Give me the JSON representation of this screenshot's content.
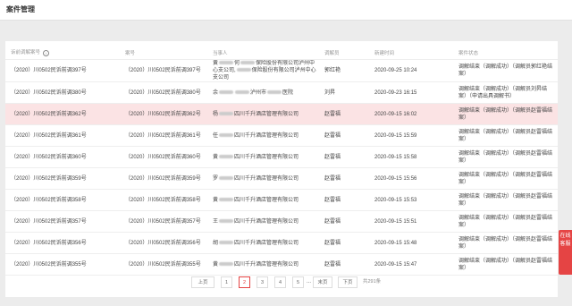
{
  "page_title": "案件管理",
  "columns": [
    "诉前调解案号",
    "案号",
    "当事人",
    "调解员",
    "新建时间",
    "案件状态"
  ],
  "rows": [
    {
      "pre_no": "（2020）川0502民诉前调397号",
      "case_no": "（2020）川0502民诉前调397号",
      "party_a": "黄",
      "party_a2": "何",
      "party_b": "保险股份有限公司泸州中心支公司,",
      "party_c": "保险股份有限公司泸州中心支公司",
      "mediator": "郭红艳",
      "created": "2020-09-25 10:24",
      "status": "调解结束（调解成功）（调解员郭红艳结案）",
      "highlight": false
    },
    {
      "pre_no": "（2020）川0502民诉前调380号",
      "case_no": "（2020）川0502民诉前调380号",
      "party_a": "余",
      "party_a2": "",
      "party_b": "泸州市",
      "party_c": "医院",
      "mediator": "刘昇",
      "created": "2020-09-23 16:15",
      "status": "调解结束（调解成功）（调解员刘昇结案）（申请出具调解书）",
      "highlight": false
    },
    {
      "pre_no": "（2020）川0502民诉前调362号",
      "case_no": "（2020）川0502民诉前调362号",
      "party_a": "杨",
      "party_a2": "",
      "party_b": "四川千升酒店管理有限公司",
      "party_c": "",
      "mediator": "赵雷福",
      "created": "2020-09-15 16:02",
      "status": "调解结束（调解成功）（调解员赵雷福结案）",
      "highlight": true
    },
    {
      "pre_no": "（2020）川0502民诉前调361号",
      "case_no": "（2020）川0502民诉前调361号",
      "party_a": "任",
      "party_a2": "",
      "party_b": "四川千升酒店管理有限公司",
      "party_c": "",
      "mediator": "赵雷福",
      "created": "2020-09-15 15:59",
      "status": "调解结束（调解成功）（调解员赵雷福结案）",
      "highlight": false
    },
    {
      "pre_no": "（2020）川0502民诉前调360号",
      "case_no": "（2020）川0502民诉前调360号",
      "party_a": "黄",
      "party_a2": "",
      "party_b": "四川千升酒店管理有限公司",
      "party_c": "",
      "mediator": "赵雷福",
      "created": "2020-09-15 15:58",
      "status": "调解结束（调解成功）（调解员赵雷福结案）",
      "highlight": false
    },
    {
      "pre_no": "（2020）川0502民诉前调359号",
      "case_no": "（2020）川0502民诉前调359号",
      "party_a": "罗",
      "party_a2": "",
      "party_b": "四川千升酒店管理有限公司",
      "party_c": "",
      "mediator": "赵雷福",
      "created": "2020-09-15 15:56",
      "status": "调解结束（调解成功）（调解员赵雷福结案）",
      "highlight": false
    },
    {
      "pre_no": "（2020）川0502民诉前调358号",
      "case_no": "（2020）川0502民诉前调358号",
      "party_a": "黄",
      "party_a2": "",
      "party_b": "四川千升酒店管理有限公司",
      "party_c": "",
      "mediator": "赵雷福",
      "created": "2020-09-15 15:53",
      "status": "调解结束（调解成功）（调解员赵雷福结案）",
      "highlight": false
    },
    {
      "pre_no": "（2020）川0502民诉前调357号",
      "case_no": "（2020）川0502民诉前调357号",
      "party_a": "王",
      "party_a2": "",
      "party_b": "四川千升酒店管理有限公司",
      "party_c": "",
      "mediator": "赵雷福",
      "created": "2020-09-15 15:51",
      "status": "调解结束（调解成功）（调解员赵雷福结案）",
      "highlight": false
    },
    {
      "pre_no": "（2020）川0502民诉前调356号",
      "case_no": "（2020）川0502民诉前调356号",
      "party_a": "胡",
      "party_a2": "",
      "party_b": "四川千升酒店管理有限公司",
      "party_c": "",
      "mediator": "赵雷福",
      "created": "2020-09-15 15:48",
      "status": "调解结束（调解成功）（调解员赵雷福结案）",
      "highlight": false
    },
    {
      "pre_no": "（2020）川0502民诉前调355号",
      "case_no": "（2020）川0502民诉前调355号",
      "party_a": "黄",
      "party_a2": "",
      "party_b": "四川千升酒店管理有限公司",
      "party_c": "",
      "mediator": "赵雷福",
      "created": "2020-09-15 15:47",
      "status": "调解结束（调解成功）（调解员赵雷福结案）",
      "highlight": false
    }
  ],
  "pagination": {
    "prev": "上页",
    "pages": [
      "1",
      "2",
      "3",
      "4",
      "5"
    ],
    "active": "2",
    "ellipsis": "...",
    "last": "末页",
    "next": "下页",
    "total": "共291条"
  },
  "online_service": "在线客服",
  "colors": {
    "accent": "#e54444",
    "highlight_row": "#fbe3e4"
  },
  "icons": {
    "column_help": "info-icon"
  }
}
